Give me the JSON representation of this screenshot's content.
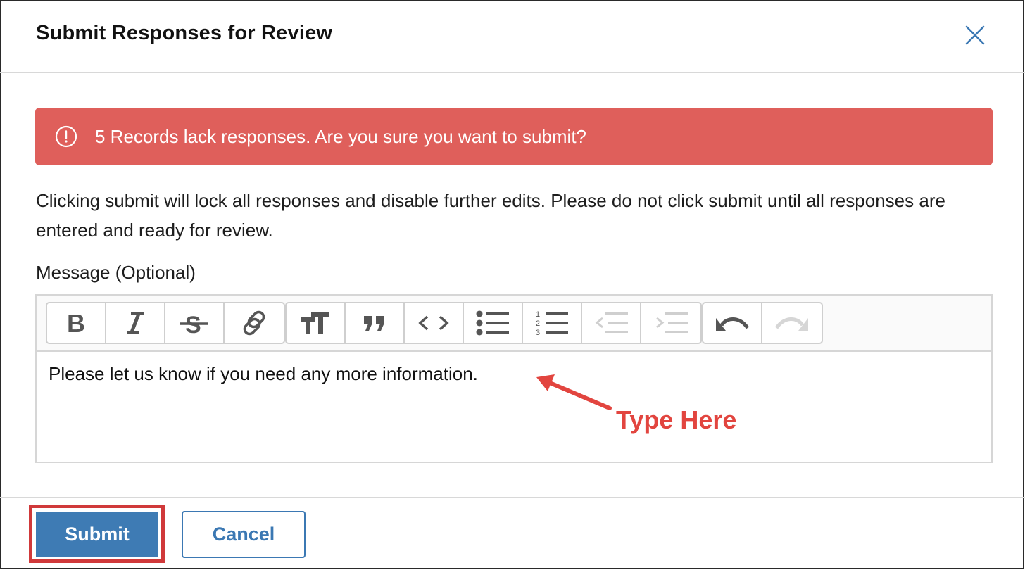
{
  "dialog": {
    "title": "Submit Responses for Review",
    "close_icon": "close-icon"
  },
  "alert": {
    "icon": "exclamation-circle-icon",
    "text": "5 Records lack responses. Are you sure you want to submit?",
    "color": "#df5f5b"
  },
  "description": "Clicking submit will lock all responses and disable further edits. Please do not click submit until all responses are entered and ready for review.",
  "message": {
    "label": "Message (Optional)",
    "value": "Please let us know if you need any more information."
  },
  "toolbar": {
    "groups": [
      [
        "bold-icon",
        "italic-icon",
        "strikethrough-icon",
        "link-icon"
      ],
      [
        "heading-icon",
        "quote-icon",
        "code-icon",
        "bullet-list-icon",
        "numbered-list-icon",
        "decrease-indent-icon",
        "increase-indent-icon"
      ],
      [
        "undo-icon",
        "redo-icon"
      ]
    ],
    "disabled": [
      "decrease-indent-icon",
      "increase-indent-icon",
      "redo-icon"
    ]
  },
  "annotation": {
    "text": "Type Here",
    "color": "#e2453f"
  },
  "footer": {
    "submit_label": "Submit",
    "cancel_label": "Cancel",
    "primary_color": "#3e7bb4"
  }
}
